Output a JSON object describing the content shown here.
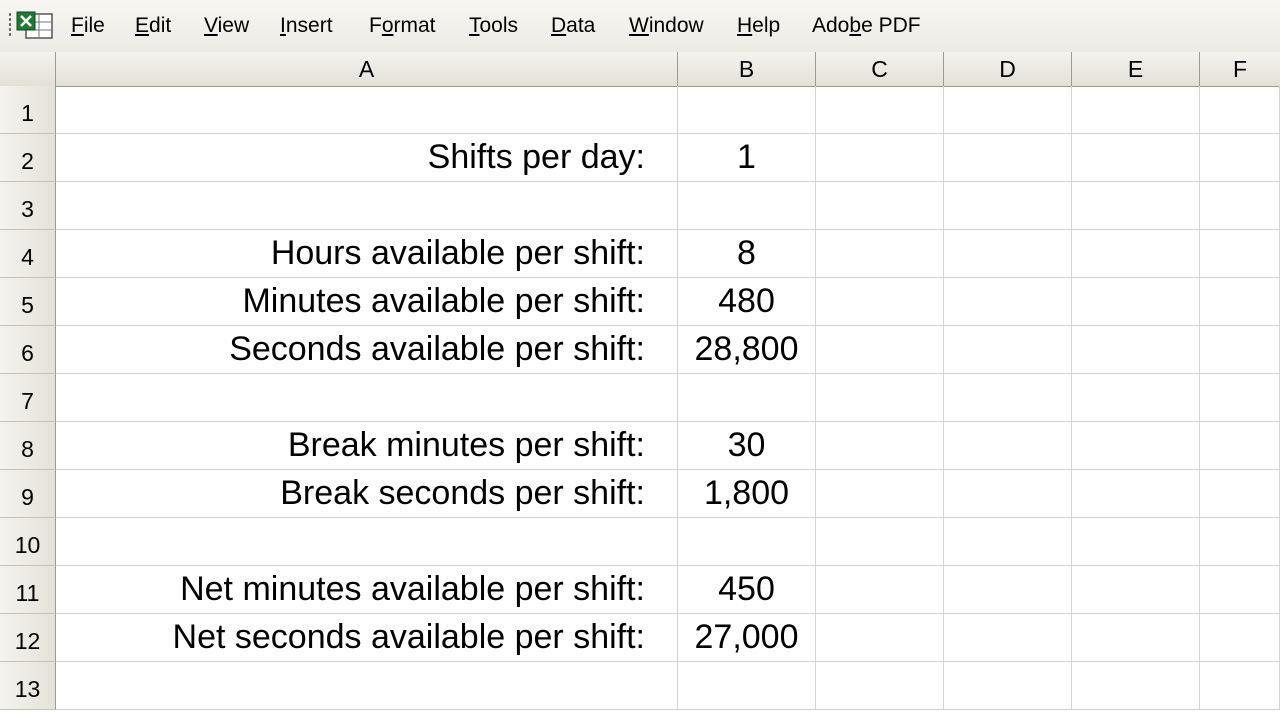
{
  "menu": [
    {
      "pre": "",
      "key": "F",
      "post": "ile"
    },
    {
      "pre": "",
      "key": "E",
      "post": "dit"
    },
    {
      "pre": "",
      "key": "V",
      "post": "iew"
    },
    {
      "pre": "",
      "key": "I",
      "post": "nsert"
    },
    {
      "pre": "F",
      "key": "o",
      "post": "rmat"
    },
    {
      "pre": "",
      "key": "T",
      "post": "ools"
    },
    {
      "pre": "",
      "key": "D",
      "post": "ata"
    },
    {
      "pre": "",
      "key": "W",
      "post": "indow"
    },
    {
      "pre": "",
      "key": "H",
      "post": "elp"
    },
    {
      "pre": "Ado",
      "key": "b",
      "post": "e PDF"
    }
  ],
  "columns": [
    "A",
    "B",
    "C",
    "D",
    "E",
    "F"
  ],
  "rows": [
    {
      "num": "1",
      "a": "",
      "b": ""
    },
    {
      "num": "2",
      "a": "Shifts per day:",
      "b": "1"
    },
    {
      "num": "3",
      "a": "",
      "b": ""
    },
    {
      "num": "4",
      "a": "Hours available per shift:",
      "b": "8"
    },
    {
      "num": "5",
      "a": "Minutes available per shift:",
      "b": "480"
    },
    {
      "num": "6",
      "a": "Seconds available per shift:",
      "b": "28,800"
    },
    {
      "num": "7",
      "a": "",
      "b": ""
    },
    {
      "num": "8",
      "a": "Break minutes per shift:",
      "b": "30"
    },
    {
      "num": "9",
      "a": "Break seconds per shift:",
      "b": "1,800"
    },
    {
      "num": "10",
      "a": "",
      "b": ""
    },
    {
      "num": "11",
      "a": "Net minutes available per shift:",
      "b": "450"
    },
    {
      "num": "12",
      "a": "Net seconds available per shift:",
      "b": "27,000"
    },
    {
      "num": "13",
      "a": "",
      "b": ""
    }
  ],
  "icons": {
    "app": "excel-icon",
    "grip": "toolbar-grip-icon"
  },
  "colors": {
    "excel_green": "#1e7b34",
    "menu_bg": "#ecebe4",
    "gridline": "#d4d3d0"
  }
}
